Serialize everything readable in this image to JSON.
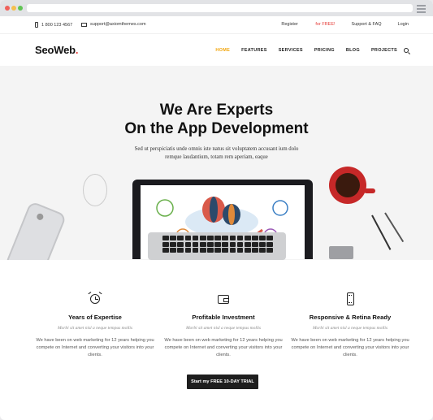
{
  "topbar": {
    "phone": "1 800 123 4567",
    "email": "support@axiomthemes.com",
    "register_prefix": "Register ",
    "register_highlight": "for FREE!",
    "support": "Support & FAQ",
    "login": "Login"
  },
  "header": {
    "logo": "SeoWeb",
    "logo_dot": ".",
    "nav": [
      "HOME",
      "FEATURES",
      "SERVICES",
      "PRICING",
      "BLOG",
      "PROJECTS"
    ],
    "active_nav": "HOME"
  },
  "hero": {
    "title_line1": "We Are Experts",
    "title_line2": "On the App Development",
    "subtitle": "Sed ut perspiciatis unde omnis iste natus sit voluptatem accusant ium dolo remque laudantium, totam rem aperiam, eaque"
  },
  "features": [
    {
      "icon": "alarm-clock-icon",
      "title": "Years of Expertise",
      "tag": "Morbi sit amet nisl a neque tempus mollis",
      "text": "We have been on web marketing for 12 years helping you compete on Internet and converting your visitors into your clients."
    },
    {
      "icon": "wallet-icon",
      "title": "Profitable Investment",
      "tag": "Morbi sit amet nisl a neque tempus mollis",
      "text": "We have been on web marketing for 12 years helping you compete on Internet and converting your visitors into your clients."
    },
    {
      "icon": "mobile-icon",
      "title": "Responsive & Retina Ready",
      "tag": "Morbi sit amet nisl a neque tempus mollis",
      "text": "We have been on web marketing for 12 years helping you compete on Internet and converting your visitors into your clients."
    }
  ],
  "cta": {
    "label": "Start my FREE 10-DAY TRIAL"
  },
  "colors": {
    "accent": "#f2a60d",
    "brand_red": "#e53935",
    "hero_bg": "#f4f4f4",
    "button_bg": "#1e1e1e"
  }
}
